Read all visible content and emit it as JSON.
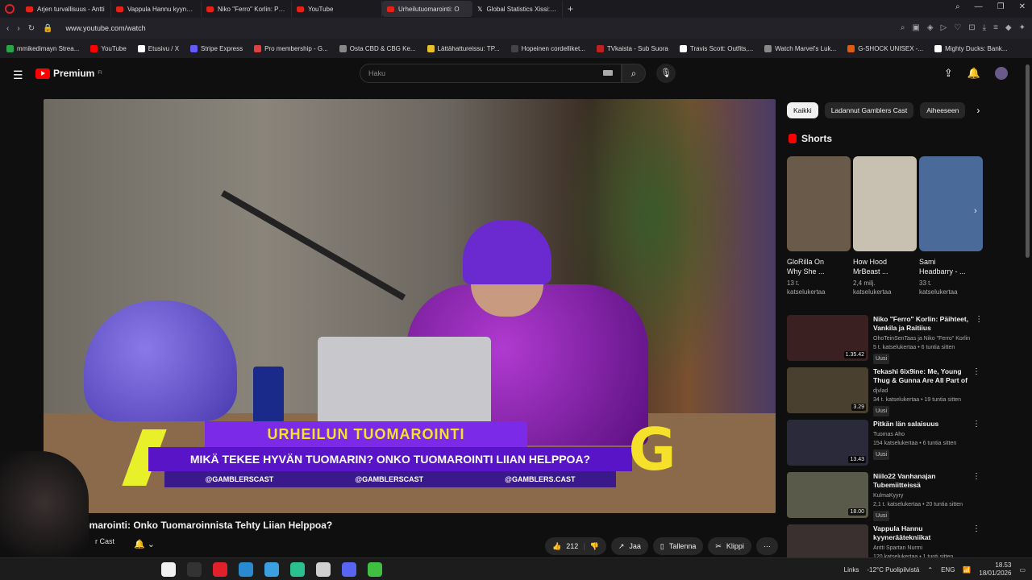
{
  "browser": {
    "tabs": [
      {
        "label": "Arjen turvallisuus - Antti",
        "icon": "youtube"
      },
      {
        "label": "Vappula Hannu kyynerää",
        "icon": "youtube"
      },
      {
        "label": "Niko \"Ferro\" Korlin: Päihte",
        "icon": "youtube"
      },
      {
        "label": "YouTube",
        "icon": "youtube"
      },
      {
        "label": "Urheilutuomarointi: O",
        "icon": "youtube",
        "active": true
      },
      {
        "label": "Global Statistics Xissi: \"10",
        "icon": "x"
      }
    ],
    "url": "www.youtube.com/watch",
    "bookmarks": [
      {
        "label": "mmikedimayn Strea...",
        "color": "#2aa44a"
      },
      {
        "label": "YouTube",
        "color": "#ff0000"
      },
      {
        "label": "Etusivu / X",
        "color": "#ffffff"
      },
      {
        "label": "Stripe Express",
        "color": "#635bff"
      },
      {
        "label": "Pro membership - G...",
        "color": "#e04040"
      },
      {
        "label": "Osta CBD & CBG Ke...",
        "color": "#888888"
      },
      {
        "label": "Lättähattureissu: TP...",
        "color": "#e8c02a"
      },
      {
        "label": "Hopeinen cordelliket...",
        "color": "#444444"
      },
      {
        "label": "TVkaista - Sub Suora",
        "color": "#c02020"
      },
      {
        "label": "Travis Scott: Outfits,...",
        "color": "#ffffff"
      },
      {
        "label": "Watch Marvel's Luk...",
        "color": "#888888"
      },
      {
        "label": "G-SHOCK UNISEX -...",
        "color": "#e05a10"
      },
      {
        "label": "Mighty Ducks: Bank...",
        "color": "#ffffff"
      }
    ]
  },
  "youtube": {
    "logo_text": "Premium",
    "logo_sup": "FI",
    "search_placeholder": "Haku"
  },
  "video": {
    "banner_title": "URHEILUN TUOMAROINTI",
    "banner_subtitle": "MIKÄ TEKEE HYVÄN TUOMARIN? ONKO TUOMAROINTI LIIAN HELPPOA?",
    "banner_handles": [
      "@GAMBLERSCAST",
      "@GAMBLERSCAST",
      "@GAMBLERS.CAST"
    ],
    "banner_logo": "G",
    "title": "uomarointi: Onko Tuomaroinnista Tehty Liian Helppoa?",
    "channel": "r Cast",
    "likes": "212",
    "share_label": "Jaa",
    "save_label": "Tallenna",
    "clip_label": "Klippi"
  },
  "sidebar": {
    "chips": [
      "Kaikki",
      "Ladannut Gamblers Cast",
      "Aiheeseen"
    ],
    "shorts_heading": "Shorts",
    "shorts": [
      {
        "title": "GloRilla On\nWhy She ...",
        "views": "13 t.\nkatselukertaa",
        "color": "#6a5a4a"
      },
      {
        "title": "How Hood\nMrBeast ...",
        "views": "2,4 milj.\nkatselukertaa",
        "color": "#c8c0b0"
      },
      {
        "title": "Sami\nHeadbarry - ...",
        "views": "33 t.\nkatselukertaa",
        "color": "#4a6a9a"
      }
    ],
    "recommended": [
      {
        "title": "Niko \"Ferro\" Korlin: Päihteet, Vankila ja Raitiius",
        "channel": "OhoTeinSenTaas ja Niko \"Ferro\" Korlin",
        "meta": "5 t. katselukertaa • 6 tuntia sitten",
        "duration": "1.35.42",
        "new": "Uusi",
        "color": "#3a2020"
      },
      {
        "title": "Tekashi 6ix9ine: Me, Young Thug & Gunna Are All Part of ...",
        "channel": "djvlad",
        "meta": "34 t. katselukertaa • 19 tuntia sitten",
        "duration": "3.29",
        "new": "Uusi",
        "color": "#4a4030"
      },
      {
        "title": "Pitkän län salaisuus",
        "channel": "Tuomas Aho",
        "meta": "154 katselukertaa • 6 tuntia sitten",
        "duration": "13.43",
        "new": "Uusi",
        "color": "#2a2a3a"
      },
      {
        "title": "Niilo22 Vanhanajan Tubemiitteissä",
        "channel": "KulmaKyyry",
        "meta": "2,1 t. katselukertaa • 20 tuntia sitten",
        "duration": "18.00",
        "new": "Uusi",
        "color": "#5a5a4a"
      },
      {
        "title": "Vappula Hannu kyynerääteknii­kat",
        "channel": "Antti Spartan Nurmi",
        "meta": "120 katselukertaa • 1 tunti sitten",
        "duration": "",
        "new": "",
        "color": "#3a3030"
      }
    ]
  },
  "taskbar": {
    "links_label": "Links",
    "weather": "-12°C  Puolipilvistä",
    "lang": "ENG",
    "time": "18.53",
    "date": "18/01/2026",
    "apps": [
      {
        "name": "explorer",
        "color": "#f0f0f0"
      },
      {
        "name": "task-view",
        "color": "#333333"
      },
      {
        "name": "opera",
        "color": "#e0202a"
      },
      {
        "name": "edge",
        "color": "#2a8ad0"
      },
      {
        "name": "store",
        "color": "#3aa0e0"
      },
      {
        "name": "app-green",
        "color": "#2ac090"
      },
      {
        "name": "vpn",
        "color": "#d0d0d0"
      },
      {
        "name": "discord",
        "color": "#5865f2"
      },
      {
        "name": "app-arrow",
        "color": "#40c040"
      }
    ]
  }
}
